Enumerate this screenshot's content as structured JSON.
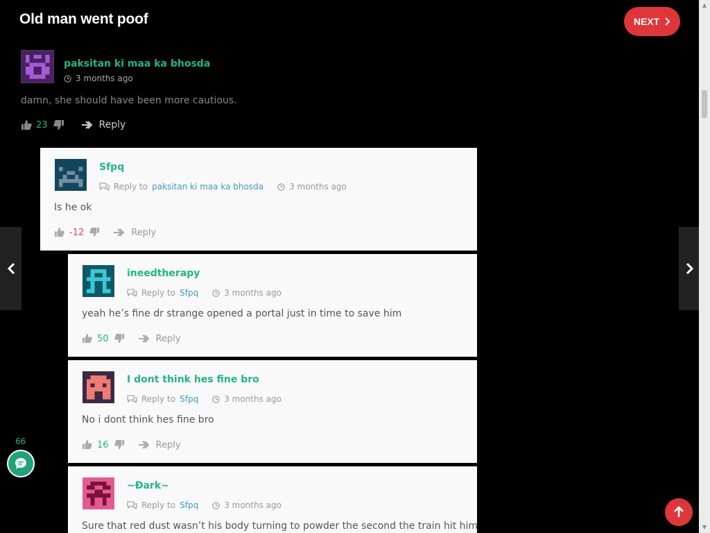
{
  "title": "Old man went poof",
  "next_label": "NEXT",
  "comments_count": "66",
  "colors": {
    "accent": "#1fb784",
    "link": "#3a9fbd",
    "red": "#e0363a",
    "negative": "#e04b4b",
    "card_bg": "#f9f9f9"
  },
  "comments": [
    {
      "author": "paksitan ki maa ka bhosda",
      "time": "3 months ago",
      "text": "damn, she should have been more cautious.",
      "votes": "23",
      "reply_label": "Reply"
    },
    {
      "author": "Sfpq",
      "reply_prefix": "Reply to",
      "reply_to": "paksitan ki maa ka bhosda",
      "time": "3 months ago",
      "text": "Is he ok",
      "votes": "-12",
      "reply_label": "Reply"
    },
    {
      "author": "ineedtherapy",
      "reply_prefix": "Reply to",
      "reply_to": "Sfpq",
      "time": "3 months ago",
      "text": "yeah he’s fine dr strange opened a portal just in time to save him",
      "votes": "50",
      "reply_label": "Reply"
    },
    {
      "author": "I dont think hes fine bro",
      "reply_prefix": "Reply to",
      "reply_to": "Sfpq",
      "time": "3 months ago",
      "text": "No i dont think hes fine bro",
      "votes": "16",
      "reply_label": "Reply"
    },
    {
      "author": "~Ðark~",
      "reply_prefix": "Reply to",
      "reply_to": "Sfpq",
      "time": "3 months ago",
      "text": "Sure that red dust wasn’t his body turning to powder the second the train hit him"
    }
  ]
}
